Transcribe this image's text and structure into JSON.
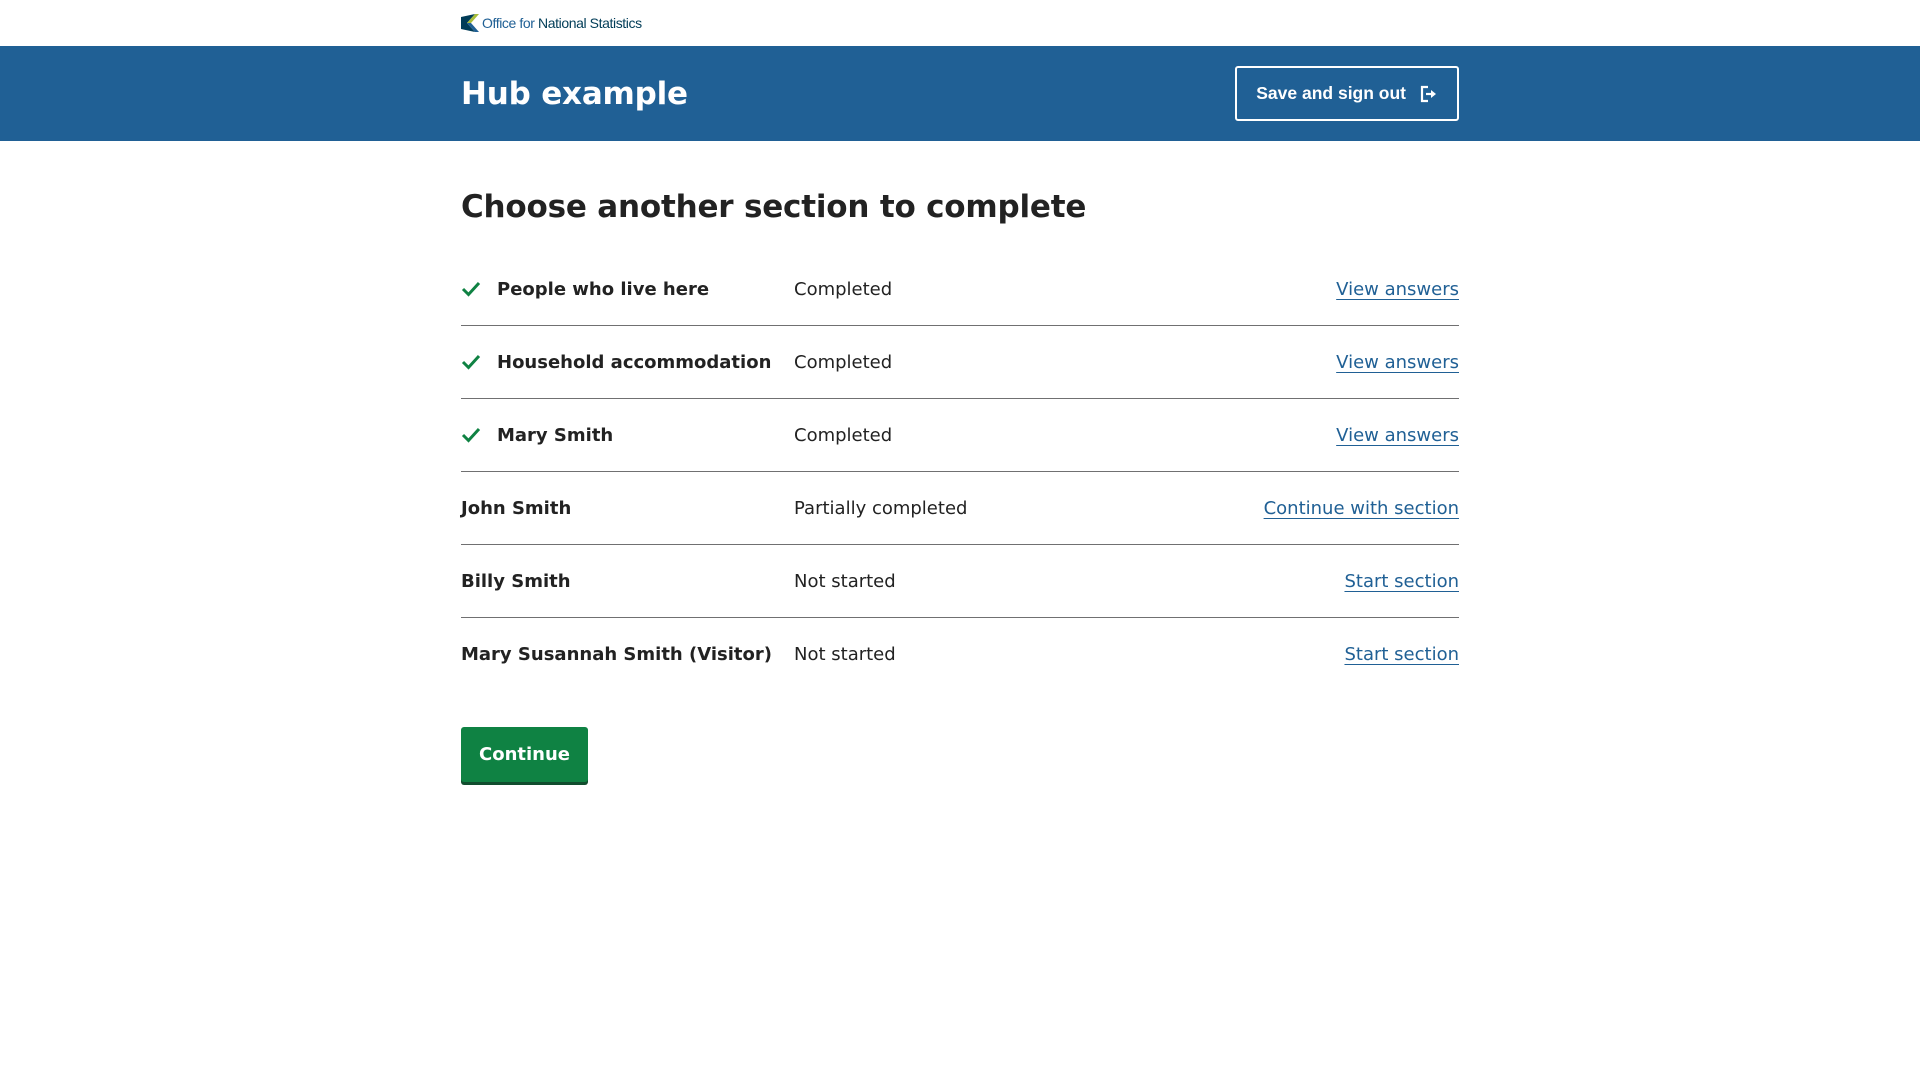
{
  "brand": {
    "logo_text_light": "Office for ",
    "logo_text_strong": "National Statistics",
    "colors": {
      "navy": "#003c57",
      "blue": "#206095",
      "green": "#a8bd3a"
    },
    "icon": "ons-logo-icon"
  },
  "header": {
    "title": "Hub example",
    "signout_label": "Save and sign out",
    "signout_icon": "exit-icon",
    "background": "#206095"
  },
  "main": {
    "page_title": "Choose another section to complete",
    "sections": [
      {
        "name": "People who live here",
        "status": "Completed",
        "action": "View answers",
        "completed": true
      },
      {
        "name": "Household accommodation",
        "status": "Completed",
        "action": "View answers",
        "completed": true
      },
      {
        "name": "Mary Smith",
        "status": "Completed",
        "action": "View answers",
        "completed": true
      },
      {
        "name": "John Smith",
        "status": "Partially completed",
        "action": "Continue with section",
        "completed": false
      },
      {
        "name": "Billy Smith",
        "status": "Not started",
        "action": "Start section",
        "completed": false
      },
      {
        "name": "Mary Susannah Smith (Visitor)",
        "status": "Not started",
        "action": "Start section",
        "completed": false
      }
    ],
    "check_icon": "check-icon",
    "check_color": "#0f8243",
    "continue_label": "Continue",
    "continue_color": "#0f8243"
  }
}
